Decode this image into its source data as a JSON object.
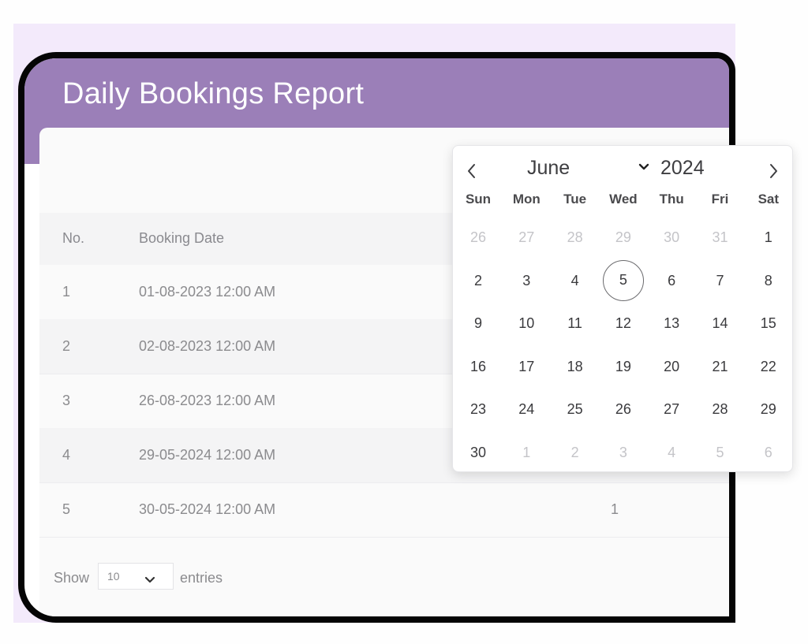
{
  "report": {
    "title": "Daily Bookings Report",
    "columns": {
      "no": "No.",
      "booking_date": "Booking Date"
    },
    "rows": [
      {
        "no": "1",
        "date": "01-08-2023 12:00 AM",
        "extra": ""
      },
      {
        "no": "2",
        "date": "02-08-2023 12:00 AM",
        "extra": ""
      },
      {
        "no": "3",
        "date": "26-08-2023 12:00 AM",
        "extra": ""
      },
      {
        "no": "4",
        "date": "29-05-2024 12:00 AM",
        "extra": ""
      },
      {
        "no": "5",
        "date": "30-05-2024 12:00 AM",
        "extra": "1"
      }
    ],
    "footer": {
      "show_label": "Show",
      "page_size": "10",
      "entries_label": "entries"
    }
  },
  "calendar": {
    "month": "June",
    "year": "2024",
    "weekdays": [
      "Sun",
      "Mon",
      "Tue",
      "Wed",
      "Thu",
      "Fri",
      "Sat"
    ],
    "weeks": [
      [
        {
          "d": "26",
          "m": true
        },
        {
          "d": "27",
          "m": true
        },
        {
          "d": "28",
          "m": true
        },
        {
          "d": "29",
          "m": true
        },
        {
          "d": "30",
          "m": true
        },
        {
          "d": "31",
          "m": true
        },
        {
          "d": "1",
          "m": false
        }
      ],
      [
        {
          "d": "2",
          "m": false
        },
        {
          "d": "3",
          "m": false
        },
        {
          "d": "4",
          "m": false
        },
        {
          "d": "5",
          "m": false
        },
        {
          "d": "6",
          "m": false
        },
        {
          "d": "7",
          "m": false
        },
        {
          "d": "8",
          "m": false
        }
      ],
      [
        {
          "d": "9",
          "m": false
        },
        {
          "d": "10",
          "m": false
        },
        {
          "d": "11",
          "m": false
        },
        {
          "d": "12",
          "m": false
        },
        {
          "d": "13",
          "m": false
        },
        {
          "d": "14",
          "m": false
        },
        {
          "d": "15",
          "m": false
        }
      ],
      [
        {
          "d": "16",
          "m": false
        },
        {
          "d": "17",
          "m": false
        },
        {
          "d": "18",
          "m": false
        },
        {
          "d": "19",
          "m": false
        },
        {
          "d": "20",
          "m": false
        },
        {
          "d": "21",
          "m": false
        },
        {
          "d": "22",
          "m": false
        }
      ],
      [
        {
          "d": "23",
          "m": false
        },
        {
          "d": "24",
          "m": false
        },
        {
          "d": "25",
          "m": false
        },
        {
          "d": "26",
          "m": false
        },
        {
          "d": "27",
          "m": false
        },
        {
          "d": "28",
          "m": false
        },
        {
          "d": "29",
          "m": false
        }
      ],
      [
        {
          "d": "30",
          "m": false
        },
        {
          "d": "1",
          "m": true
        },
        {
          "d": "2",
          "m": true
        },
        {
          "d": "3",
          "m": true
        },
        {
          "d": "4",
          "m": true
        },
        {
          "d": "5",
          "m": true
        },
        {
          "d": "6",
          "m": true
        }
      ]
    ],
    "selected_day": "5",
    "icons": {
      "prev": "chevron-left-icon",
      "next": "chevron-right-icon",
      "month_dropdown": "chevron-down-icon"
    }
  },
  "colors": {
    "header": "#9b7fb8",
    "backdrop": "#f3eafb",
    "device_frame": "#050505"
  }
}
